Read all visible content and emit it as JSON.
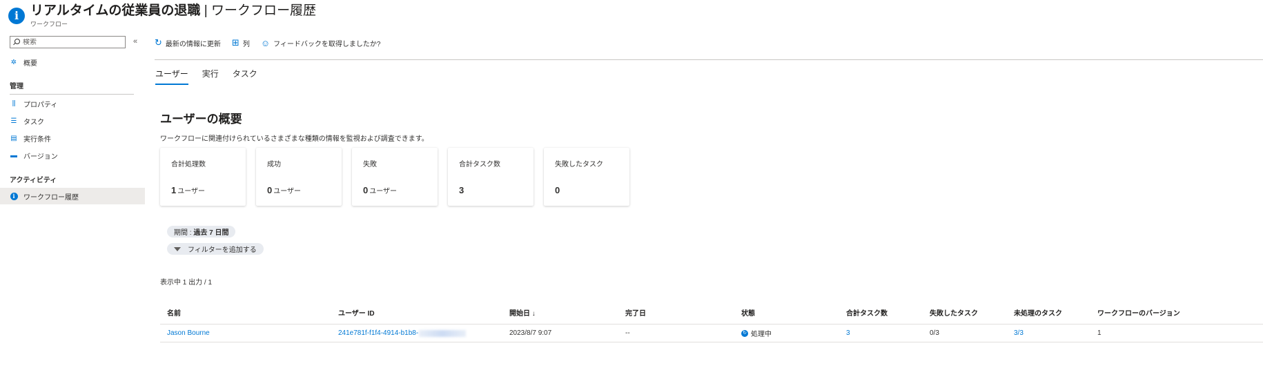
{
  "header": {
    "title_main": "リアルタイムの従業員の退職",
    "title_sep": " | ",
    "title_page": "ワークフロー履歴",
    "subtitle": "ワークフロー",
    "more": "···",
    "icon": "info-icon"
  },
  "sidebar": {
    "search_placeholder": "検索",
    "collapse": "«",
    "overview": "概要",
    "section_manage": "管理",
    "items_manage": [
      "プロパティ",
      "タスク",
      "実行条件",
      "バージョン"
    ],
    "section_activity": "アクティビティ",
    "active_item": "ワークフロー履歴"
  },
  "toolbar": {
    "refresh": "最新の情報に更新",
    "columns": "列",
    "feedback": "フィードバックを取得しましたか?"
  },
  "tabs": [
    "ユーザー",
    "実行",
    "タスク"
  ],
  "summary": {
    "title": "ユーザーの概要",
    "description": "ワークフローに関連付けられているさまざまな種類の情報を監視および調査できます。",
    "cards": [
      {
        "label": "合計処理数",
        "value": "1",
        "unit": "ユーザー"
      },
      {
        "label": "成功",
        "value": "0",
        "unit": "ユーザー"
      },
      {
        "label": "失敗",
        "value": "0",
        "unit": "ユーザー"
      },
      {
        "label": "合計タスク数",
        "value": "3",
        "unit": ""
      },
      {
        "label": "失敗したタスク",
        "value": "0",
        "unit": ""
      }
    ]
  },
  "filters": {
    "period_label": "期間 : ",
    "period_value": "過去 7 日間",
    "add_filter": "フィルターを追加する"
  },
  "showing": "表示中 1 出力 / 1",
  "table": {
    "columns": [
      "名前",
      "ユーザー ID",
      "開始日 ↓",
      "完了日",
      "状態",
      "合計タスク数",
      "失敗したタスク",
      "未処理のタスク",
      "ワークフローのバージョン"
    ],
    "rows": [
      {
        "name": "Jason Bourne",
        "user_id": "241e781f-f1f4-4914-b1b8-",
        "start": "2023/8/7 9:07",
        "end": "--",
        "status": "処理中",
        "total_tasks": "3",
        "failed_tasks": "0/3",
        "pending_tasks": "3/3",
        "version": "1"
      }
    ]
  }
}
